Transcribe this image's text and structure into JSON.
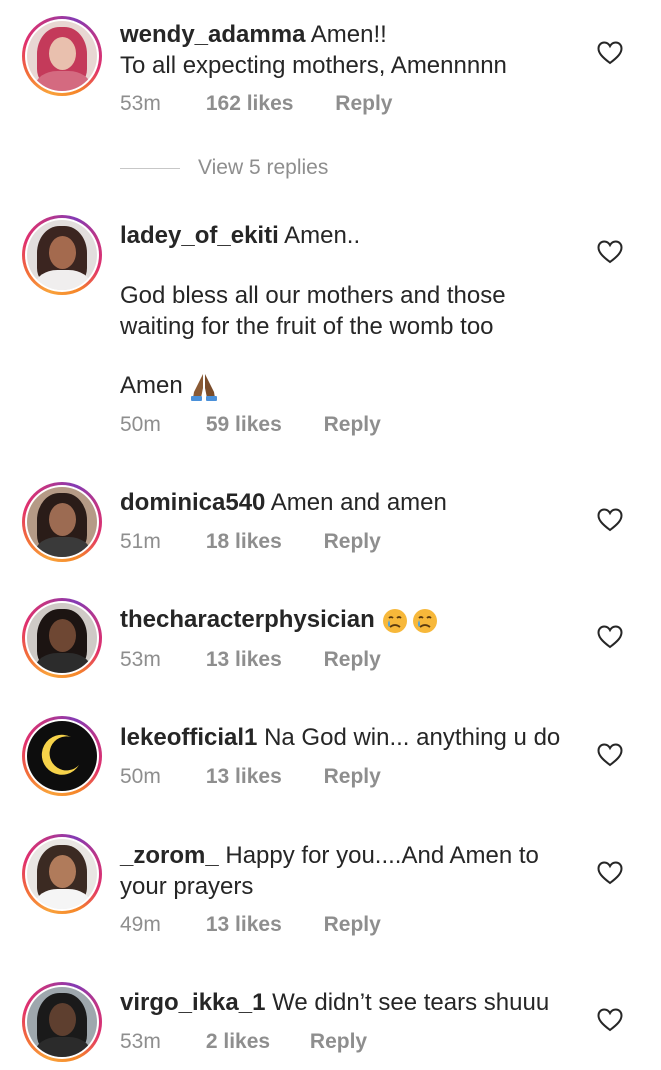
{
  "comments": [
    {
      "username": "wendy_adamma",
      "text": "Amen!!",
      "text2": "To all expecting mothers, Amennnnn",
      "time": "53m",
      "likes": "162 likes",
      "reply": "Reply",
      "view_replies": "View 5 replies"
    },
    {
      "username": "ladey_of_ekiti",
      "text": "Amen..",
      "text2": "God bless all our mothers and those",
      "text3": "waiting for the fruit of the womb too",
      "text4": "Amen",
      "emoji": "folded-hands",
      "time": "50m",
      "likes": "59 likes",
      "reply": "Reply"
    },
    {
      "username": "dominica540",
      "text": "Amen and amen",
      "time": "51m",
      "likes": "18 likes",
      "reply": "Reply"
    },
    {
      "username": "thecharacterphysician",
      "text": "",
      "emoji": "crying-face-x2",
      "time": "53m",
      "likes": "13 likes",
      "reply": "Reply"
    },
    {
      "username": "lekeofficial1",
      "text": "Na God win... anything u do",
      "time": "50m",
      "likes": "13 likes",
      "reply": "Reply"
    },
    {
      "username": "_zorom_",
      "text": "Happy for you....And Amen to",
      "text2": "your prayers",
      "time": "49m",
      "likes": "13 likes",
      "reply": "Reply"
    },
    {
      "username": "virgo_ikka_1",
      "text": "We didn’t see tears shuuu",
      "time": "53m",
      "likes": "2 likes",
      "reply": "Reply"
    }
  ],
  "icons": {
    "like": "heart-outline-icon"
  },
  "colors": {
    "text": "#262626",
    "secondary": "#8e8e8e",
    "divider": "#c7c7c7"
  }
}
